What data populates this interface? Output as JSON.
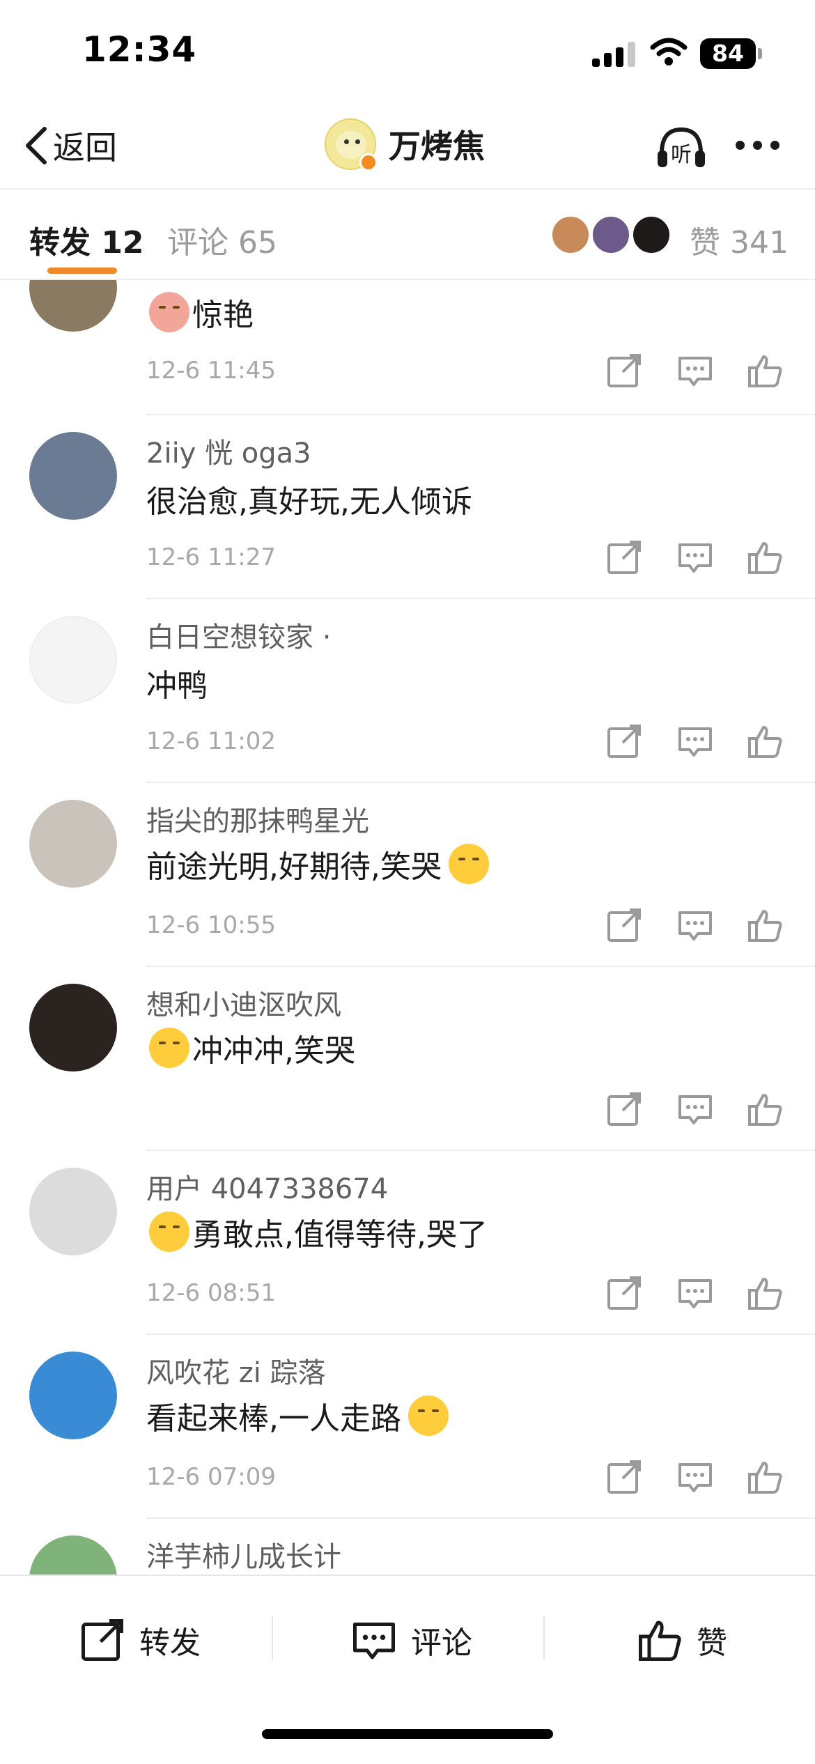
{
  "status": {
    "time": "12:34",
    "battery": "84"
  },
  "nav": {
    "back_label": "返回",
    "title": "万烤焦",
    "listen_label": "听"
  },
  "tabs": {
    "forward": "转发 12",
    "comment": "评论 65",
    "likes": "赞 341"
  },
  "comments": [
    {
      "name": "",
      "text": "惊艳",
      "time": "12-6 11:45",
      "avatar_color": "#8b7a62",
      "emoji_before": "hat"
    },
    {
      "name": "2iiy 恍 oga3",
      "text": "很治愈,真好玩,无人倾诉",
      "time": "12-6 11:27",
      "avatar_color": "#6a7b93"
    },
    {
      "name": "白日空想铰家 ·",
      "text": "冲鸭",
      "time": "12-6 11:02",
      "avatar_color": "#f4f4f4"
    },
    {
      "name": "指尖的那抹鸭星光",
      "text": "前途光明,好期待,笑哭",
      "time": "12-6 10:55",
      "avatar_color": "#c9c3bb",
      "emoji_after": true
    },
    {
      "name": "想和小迪沤吹风",
      "text": "冲冲冲,笑哭",
      "time": "",
      "avatar_color": "#2b2320",
      "emoji_before": "kiss"
    },
    {
      "name": "用户 4047338674",
      "text": "勇敢点,值得等待,哭了",
      "time": "12-6 08:51",
      "avatar_color": "#dcdcdc",
      "emoji_before": "think"
    },
    {
      "name": "风吹花 zi 踪落",
      "text": "看起来棒,一人走路",
      "time": "12-6 07:09",
      "avatar_color": "#3a8bd6",
      "emoji_after": true
    },
    {
      "name": "洋芋柿儿成长计",
      "text": "",
      "time": "",
      "avatar_color": "#7fb37a"
    }
  ],
  "bottom": {
    "forward": "转发",
    "comment": "评论",
    "like": "赞"
  },
  "colors": {
    "accent": "#ee8a2a",
    "text": "#1a1a1a",
    "muted": "#9b9b9b"
  }
}
